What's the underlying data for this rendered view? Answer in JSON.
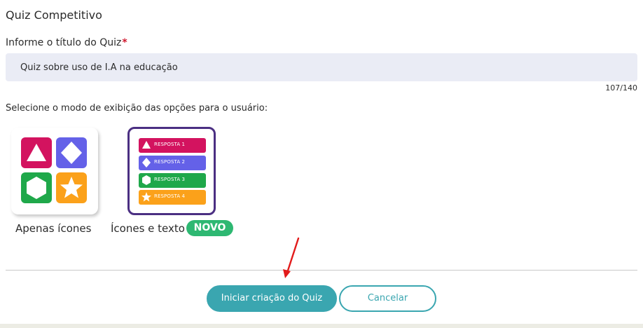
{
  "page": {
    "title": "Quiz Competitivo"
  },
  "title_field": {
    "label": "Informe o título do Quiz",
    "required_mark": "*",
    "value": "Quiz sobre uso de I.A na educação",
    "counter": "107/140"
  },
  "display_mode": {
    "prompt": "Selecione o modo de exibição das opções para o usuário:",
    "options": [
      {
        "label": "Apenas ícones",
        "selected": false
      },
      {
        "label": "Ícones e texto",
        "badge": "NOVO",
        "selected": true
      }
    ],
    "answers": [
      "RESPOSTA 1",
      "RESPOSTA 2",
      "RESPOSTA 3",
      "RESPOSTA 4"
    ],
    "answer_icons": [
      "triangle-icon",
      "diamond-icon",
      "hexagon-icon",
      "star-icon"
    ],
    "answer_colors": [
      "#d3135f",
      "#6461e8",
      "#1fa84a",
      "#fba11a"
    ],
    "selected_border_color": "#4b2f82"
  },
  "actions": {
    "start_label": "Iniciar criação do Quiz",
    "cancel_label": "Cancelar",
    "accent_color": "#3aa6b0"
  }
}
